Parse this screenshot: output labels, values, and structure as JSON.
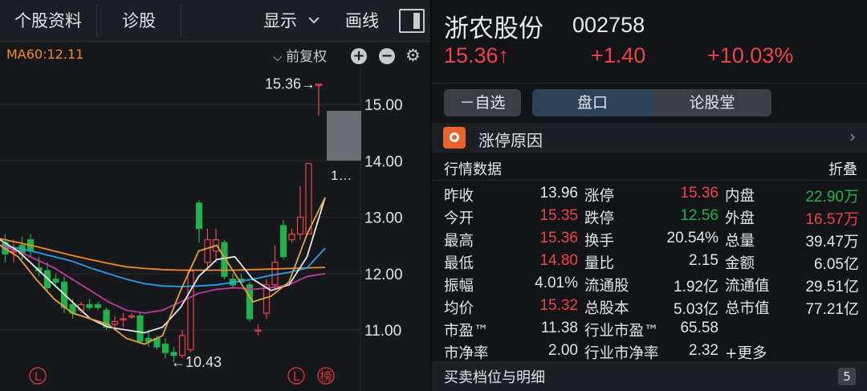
{
  "left": {
    "tabs": [
      "个股资料",
      "诊股"
    ],
    "display_label": "显示",
    "draw_label": "画线",
    "ma_label": "MA60:12.11",
    "adjust_label": "前复权",
    "plus_icon": "plus-icon",
    "minus_icon": "minus-icon",
    "gear_icon": "gear-icon"
  },
  "chart_data": {
    "type": "candlestick",
    "ylim": [
      10.25,
      15.75
    ],
    "y_ticks": [
      "15.00",
      "14.00",
      "13.00",
      "12.00",
      "11.00"
    ],
    "y_tick_values": [
      15,
      14,
      13,
      12,
      11
    ],
    "high_label": "15.36",
    "low_label": "10.43",
    "partial_label": "1…",
    "markers": [
      "L",
      "L",
      "榜"
    ],
    "up_color": "#f0424a",
    "down_color": "#22b14c",
    "candles": [
      {
        "o": 12.55,
        "c": 12.35,
        "h": 12.7,
        "l": 12.2
      },
      {
        "o": 12.4,
        "c": 12.4,
        "h": 12.6,
        "l": 12.2
      },
      {
        "o": 12.5,
        "c": 12.35,
        "h": 12.65,
        "l": 12.25
      },
      {
        "o": 12.6,
        "c": 12.4,
        "h": 12.7,
        "l": 12.3
      },
      {
        "o": 12.1,
        "c": 12.05,
        "h": 12.3,
        "l": 11.95
      },
      {
        "o": 12.05,
        "c": 11.75,
        "h": 12.2,
        "l": 11.7
      },
      {
        "o": 11.9,
        "c": 11.85,
        "h": 12.0,
        "l": 11.8
      },
      {
        "o": 11.85,
        "c": 11.4,
        "h": 11.95,
        "l": 11.3
      },
      {
        "o": 11.45,
        "c": 11.3,
        "h": 11.55,
        "l": 11.2
      },
      {
        "o": 11.35,
        "c": 11.45,
        "h": 11.5,
        "l": 11.3
      },
      {
        "o": 11.45,
        "c": 11.4,
        "h": 11.55,
        "l": 11.35
      },
      {
        "o": 11.45,
        "c": 11.4,
        "h": 11.5,
        "l": 11.35
      },
      {
        "o": 11.35,
        "c": 11.05,
        "h": 11.4,
        "l": 11.0
      },
      {
        "o": 11.1,
        "c": 11.15,
        "h": 11.25,
        "l": 11.0
      },
      {
        "o": 11.2,
        "c": 11.2,
        "h": 11.3,
        "l": 11.05
      },
      {
        "o": 11.25,
        "c": 11.25,
        "h": 11.3,
        "l": 11.2
      },
      {
        "o": 11.25,
        "c": 10.8,
        "h": 11.3,
        "l": 10.75
      },
      {
        "o": 10.85,
        "c": 10.8,
        "h": 11.0,
        "l": 10.7
      },
      {
        "o": 10.85,
        "c": 10.7,
        "h": 10.9,
        "l": 10.65
      },
      {
        "o": 10.75,
        "c": 10.6,
        "h": 10.85,
        "l": 10.5
      },
      {
        "o": 10.6,
        "c": 10.55,
        "h": 10.7,
        "l": 10.43
      },
      {
        "o": 10.55,
        "c": 10.9,
        "h": 11.0,
        "l": 10.5
      },
      {
        "o": 10.65,
        "c": 12.05,
        "h": 12.1,
        "l": 10.6
      },
      {
        "o": 13.25,
        "c": 12.8,
        "h": 13.3,
        "l": 12.55
      },
      {
        "o": 12.2,
        "c": 12.6,
        "h": 12.8,
        "l": 12.1
      },
      {
        "o": 12.4,
        "c": 12.6,
        "h": 12.8,
        "l": 12.2
      },
      {
        "o": 12.55,
        "c": 11.95,
        "h": 12.6,
        "l": 11.9
      },
      {
        "o": 11.9,
        "c": 11.8,
        "h": 12.0,
        "l": 11.75
      },
      {
        "o": 11.9,
        "c": 11.85,
        "h": 12.0,
        "l": 11.8
      },
      {
        "o": 11.8,
        "c": 11.2,
        "h": 11.85,
        "l": 11.15
      },
      {
        "o": 11.0,
        "c": 11.0,
        "h": 11.1,
        "l": 10.9
      },
      {
        "o": 11.3,
        "c": 11.8,
        "h": 11.9,
        "l": 11.2
      },
      {
        "o": 11.8,
        "c": 12.2,
        "h": 12.5,
        "l": 11.7
      },
      {
        "o": 12.85,
        "c": 12.3,
        "h": 12.95,
        "l": 12.25
      },
      {
        "o": 12.6,
        "c": 12.7,
        "h": 12.8,
        "l": 12.55
      },
      {
        "o": 12.7,
        "c": 13.0,
        "h": 13.55,
        "l": 12.6
      },
      {
        "o": 12.7,
        "c": 13.95,
        "h": 13.95,
        "l": 12.7
      },
      {
        "o": 15.35,
        "c": 15.36,
        "h": 15.36,
        "l": 14.8
      }
    ],
    "ma": [
      {
        "color": "#f08a24",
        "values": [
          12.62,
          12.55,
          12.48,
          12.4,
          12.32,
          12.25,
          12.18,
          12.12,
          12.09,
          12.07,
          12.06,
          12.06,
          12.06,
          12.06,
          12.07,
          12.08,
          12.09,
          12.1,
          12.11
        ]
      },
      {
        "color": "#26a0e8",
        "values": [
          12.5,
          12.45,
          12.38,
          12.3,
          12.22,
          12.1,
          12.0,
          11.9,
          11.82,
          11.78,
          11.77,
          11.78,
          11.8,
          11.85,
          11.9,
          11.97,
          12.02,
          12.1,
          12.45
        ]
      },
      {
        "color": "#c0389c",
        "values": [
          12.5,
          12.4,
          12.25,
          12.1,
          11.9,
          11.7,
          11.5,
          11.35,
          11.3,
          11.35,
          11.5,
          11.65,
          11.72,
          11.75,
          11.72,
          11.75,
          11.8,
          11.95,
          12.0
        ]
      },
      {
        "color": "#e8e8e8",
        "values": [
          12.6,
          12.4,
          12.1,
          11.8,
          11.5,
          11.2,
          11.05,
          11.0,
          10.95,
          11.05,
          11.4,
          11.95,
          12.25,
          12.3,
          11.9,
          11.7,
          11.8,
          12.3,
          13.35
        ]
      },
      {
        "color": "#e6a23c",
        "values": [
          12.5,
          12.3,
          11.9,
          11.55,
          11.3,
          11.2,
          11.1,
          10.85,
          10.75,
          10.9,
          11.7,
          12.4,
          12.5,
          12.0,
          11.5,
          11.6,
          11.85,
          12.7,
          13.35
        ]
      }
    ]
  },
  "stock": {
    "name": "浙农股份",
    "code": "002758",
    "price": "15.36↑",
    "change": "+1.40",
    "change_pct": "+10.03%"
  },
  "tabs": {
    "watch": "－自选",
    "pankou": "盘口",
    "forum": "论股堂"
  },
  "reason": {
    "label": "涨停原因",
    "arrow": "›"
  },
  "section": {
    "title": "行情数据",
    "fold": "折叠"
  },
  "quotes": [
    [
      {
        "l": "昨收",
        "v": "13.96",
        "c": ""
      },
      {
        "l": "涨停",
        "v": "15.36",
        "c": "red"
      },
      {
        "l": "内盘",
        "v": "22.90万",
        "c": "green"
      }
    ],
    [
      {
        "l": "今开",
        "v": "15.35",
        "c": "red"
      },
      {
        "l": "跌停",
        "v": "12.56",
        "c": "green"
      },
      {
        "l": "外盘",
        "v": "16.57万",
        "c": "red"
      }
    ],
    [
      {
        "l": "最高",
        "v": "15.36",
        "c": "red"
      },
      {
        "l": "换手",
        "v": "20.54%",
        "c": ""
      },
      {
        "l": "总量",
        "v": "39.47万",
        "c": ""
      }
    ],
    [
      {
        "l": "最低",
        "v": "14.80",
        "c": "red"
      },
      {
        "l": "量比",
        "v": "2.15",
        "c": ""
      },
      {
        "l": "金额",
        "v": "6.05亿",
        "c": ""
      }
    ],
    [
      {
        "l": "振幅",
        "v": "4.01%",
        "c": ""
      },
      {
        "l": "流通股",
        "v": "1.92亿",
        "c": ""
      },
      {
        "l": "流通值",
        "v": "29.51亿",
        "c": ""
      }
    ],
    [
      {
        "l": "均价",
        "v": "15.32",
        "c": "red"
      },
      {
        "l": "总股本",
        "v": "5.03亿",
        "c": ""
      },
      {
        "l": "总市值",
        "v": "77.21亿",
        "c": ""
      }
    ],
    [
      {
        "l": "市盈™",
        "v": "11.38",
        "c": ""
      },
      {
        "l": "行业市盈™",
        "v": "65.58",
        "c": ""
      },
      {
        "l": "",
        "v": "",
        "c": ""
      }
    ],
    [
      {
        "l": "市净率",
        "v": "2.00",
        "c": ""
      },
      {
        "l": "行业市净率",
        "v": "2.32",
        "c": ""
      },
      {
        "l": "+更多",
        "v": "",
        "c": ""
      }
    ]
  ],
  "book": {
    "title": "买卖档位与明细",
    "badge": "5"
  }
}
